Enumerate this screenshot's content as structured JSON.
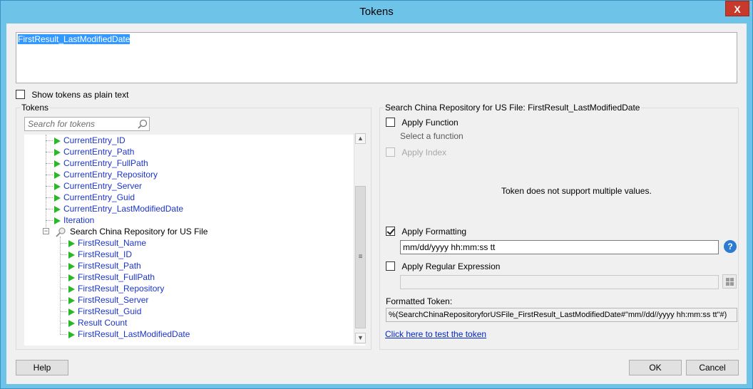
{
  "window": {
    "title": "Tokens",
    "close_label": "X"
  },
  "token_text": "FirstResult_LastModifiedDate",
  "show_plain_text_label": "Show tokens as plain text",
  "tokens_panel": {
    "title": "Tokens",
    "search_placeholder": "Search for tokens",
    "items": [
      {
        "label": "CurrentEntry_ID"
      },
      {
        "label": "CurrentEntry_Path"
      },
      {
        "label": "CurrentEntry_FullPath"
      },
      {
        "label": "CurrentEntry_Repository"
      },
      {
        "label": "CurrentEntry_Server"
      },
      {
        "label": "CurrentEntry_Guid"
      },
      {
        "label": "CurrentEntry_LastModifiedDate"
      },
      {
        "label": "Iteration"
      }
    ],
    "group": {
      "label": "Search China Repository for US File",
      "items": [
        {
          "label": "FirstResult_Name"
        },
        {
          "label": "FirstResult_ID"
        },
        {
          "label": "FirstResult_Path"
        },
        {
          "label": "FirstResult_FullPath"
        },
        {
          "label": "FirstResult_Repository"
        },
        {
          "label": "FirstResult_Server"
        },
        {
          "label": "FirstResult_Guid"
        },
        {
          "label": "Result Count"
        },
        {
          "label": "FirstResult_LastModifiedDate"
        }
      ]
    }
  },
  "details_panel": {
    "title": "Search China Repository for US File: FirstResult_LastModifiedDate",
    "apply_function_label": "Apply Function",
    "select_function_text": "Select a function",
    "apply_index_label": "Apply Index",
    "multi_values_note": "Token does not support multiple values.",
    "apply_formatting_label": "Apply Formatting",
    "format_value": "mm/dd/yyyy hh:mm:ss tt",
    "help_label": "?",
    "apply_regex_label": "Apply Regular Expression",
    "regex_value": "",
    "formatted_token_label": "Formatted Token:",
    "formatted_token_value": "%(SearchChinaRepositoryforUSFile_FirstResult_LastModifiedDate#\"mm//dd//yyyy hh:mm:ss tt\"#)",
    "test_link": "Click here to test the token"
  },
  "buttons": {
    "help": "Help",
    "ok": "OK",
    "cancel": "Cancel"
  },
  "colors": {
    "title_bar": "#6ec4e8",
    "token_link": "#1c33cc",
    "play_icon": "#28b828",
    "close": "#c7392b"
  }
}
